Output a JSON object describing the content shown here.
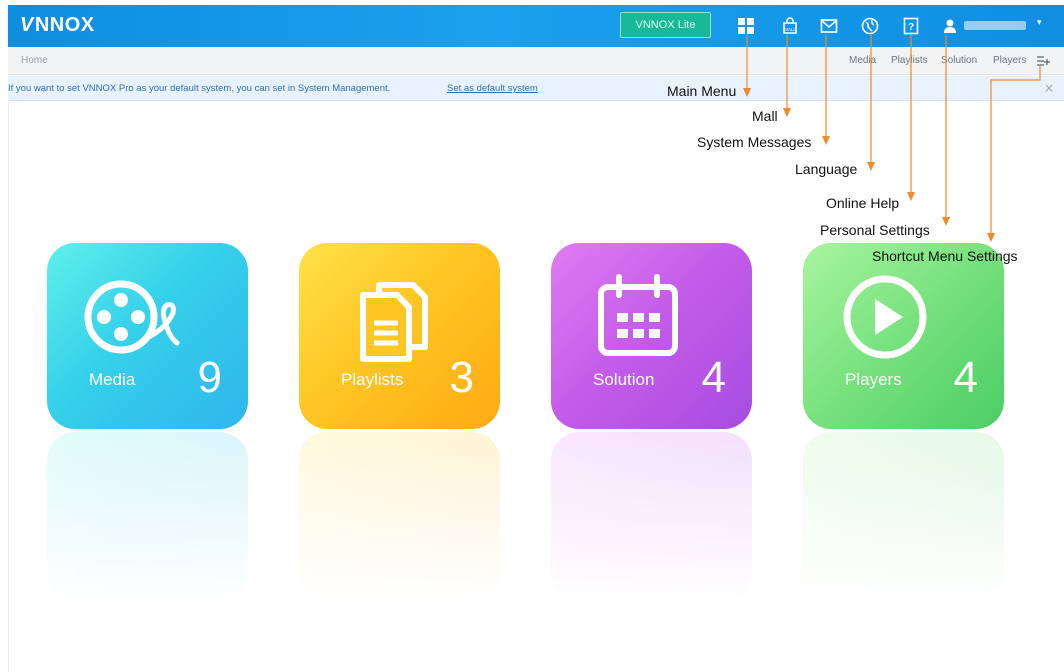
{
  "app": {
    "logo_text": "NNOX",
    "logo_mark": "V",
    "lite_button": "VNNOX Lite",
    "brand_color": "#1199e6"
  },
  "toolbar_icons": [
    "grid-icon",
    "mall-icon",
    "mail-icon",
    "globe-icon",
    "help-icon",
    "user-icon"
  ],
  "nav": {
    "home": "Home",
    "shortcuts": [
      "Media",
      "Playlists",
      "Solution",
      "Players"
    ]
  },
  "notice": {
    "text": "If you want to set VNNOX Pro as your default system, you can set in System Management.",
    "link": "Set as default system",
    "close": "×"
  },
  "tiles": [
    {
      "label": "Media",
      "count": "9"
    },
    {
      "label": "Playlists",
      "count": "3"
    },
    {
      "label": "Solution",
      "count": "4"
    },
    {
      "label": "Players",
      "count": "4"
    }
  ],
  "callouts": {
    "main_menu": "Main Menu",
    "mall": "Mall",
    "system_messages": "System Messages",
    "language": "Language",
    "online_help": "Online Help",
    "personal_settings": "Personal Settings",
    "shortcut_menu_settings": "Shortcut Menu Settings"
  },
  "colors": {
    "callout_line": "#f08a2a",
    "media": "#3ad2ea",
    "playlists": "#ffc322",
    "solution": "#c65ce9",
    "players": "#70dd7b"
  }
}
